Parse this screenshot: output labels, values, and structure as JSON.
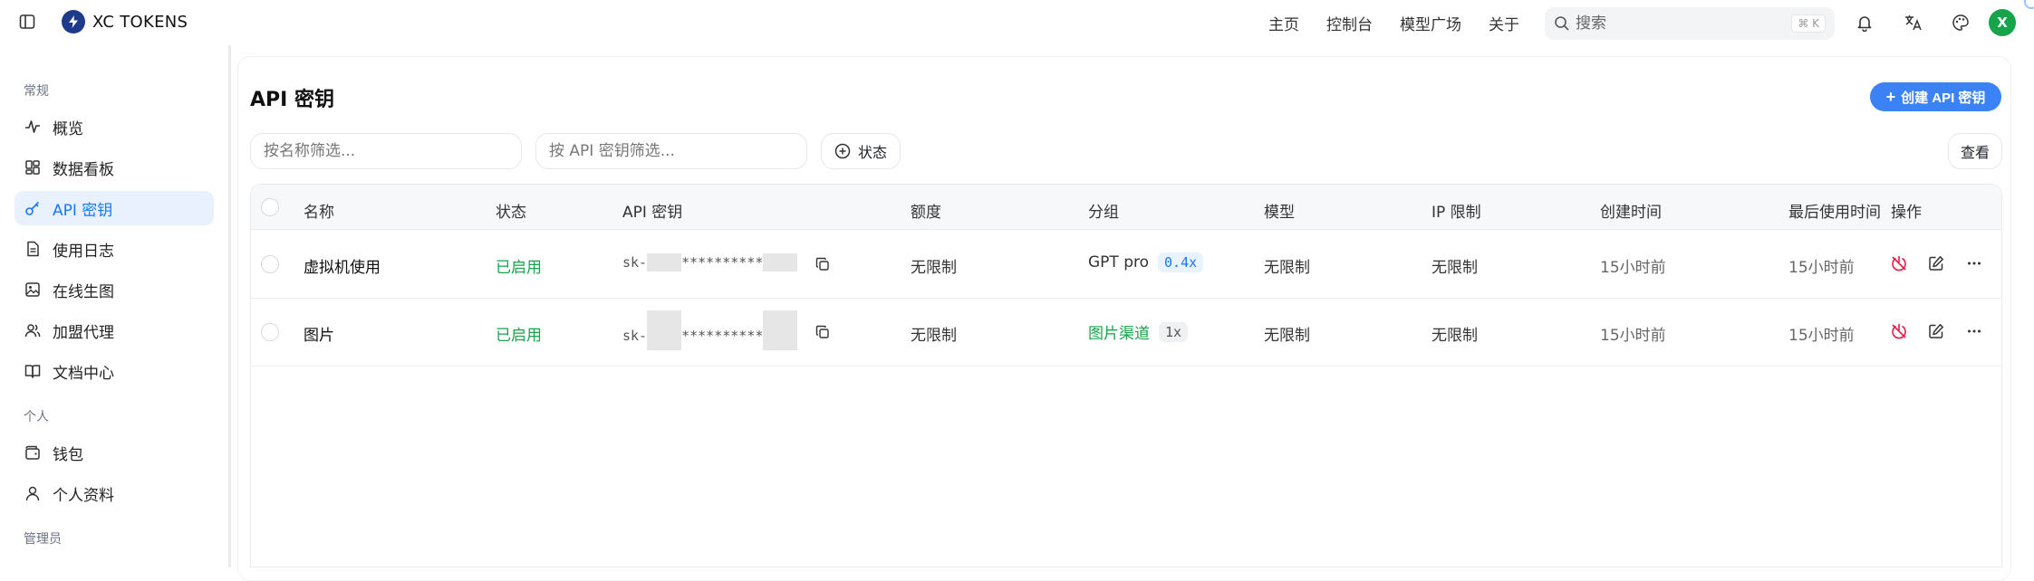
{
  "app": {
    "title": "XC TOKENS"
  },
  "nav": {
    "home": "主页",
    "console": "控制台",
    "models": "模型广场",
    "about": "关于"
  },
  "search": {
    "placeholder": "搜索",
    "shortcut": "⌘ K"
  },
  "user": {
    "avatar_letter": "X",
    "avatar_color": "#16a34a"
  },
  "sidebar": {
    "section_general": "常规",
    "section_personal": "个人",
    "section_admin": "管理员",
    "items": [
      {
        "label": "概览",
        "icon": "activity-icon"
      },
      {
        "label": "数据看板",
        "icon": "dashboard-icon"
      },
      {
        "label": "API 密钥",
        "icon": "key-icon",
        "active": true
      },
      {
        "label": "使用日志",
        "icon": "log-icon"
      },
      {
        "label": "在线生图",
        "icon": "image-icon"
      },
      {
        "label": "加盟代理",
        "icon": "users-icon"
      },
      {
        "label": "文档中心",
        "icon": "book-icon"
      },
      {
        "label": "钱包",
        "icon": "wallet-icon"
      },
      {
        "label": "个人资料",
        "icon": "user-icon"
      }
    ]
  },
  "page": {
    "title": "API 密钥",
    "create_label": "创建 API 密钥",
    "filter_name_placeholder": "按名称筛选...",
    "filter_key_placeholder": "按 API 密钥筛选...",
    "status_label": "状态",
    "view_label": "查看"
  },
  "table": {
    "headers": [
      "名称",
      "状态",
      "API 密钥",
      "额度",
      "分组",
      "模型",
      "IP 限制",
      "创建时间",
      "最后使用时间",
      "操作"
    ],
    "rows": [
      {
        "name": "虚拟机使用",
        "status": "已启用",
        "key_prefix": "sk-",
        "key_mask": "**********",
        "quota": "无限制",
        "group": "GPT pro",
        "ratio": "0.4x",
        "model": "无限制",
        "ip": "无限制",
        "created": "15小时前",
        "last_used": "15小时前"
      },
      {
        "name": "图片",
        "status": "已启用",
        "key_prefix": "sk-",
        "key_mask": "**********",
        "quota": "无限制",
        "group": "图片渠道",
        "ratio": "1x",
        "model": "无限制",
        "ip": "无限制",
        "created": "15小时前",
        "last_used": "15小时前"
      }
    ]
  },
  "colors": {
    "accent": "#1677ff",
    "primary_button": "#3b82f6",
    "enabled": "#16a34a",
    "danger": "#e11d48"
  }
}
